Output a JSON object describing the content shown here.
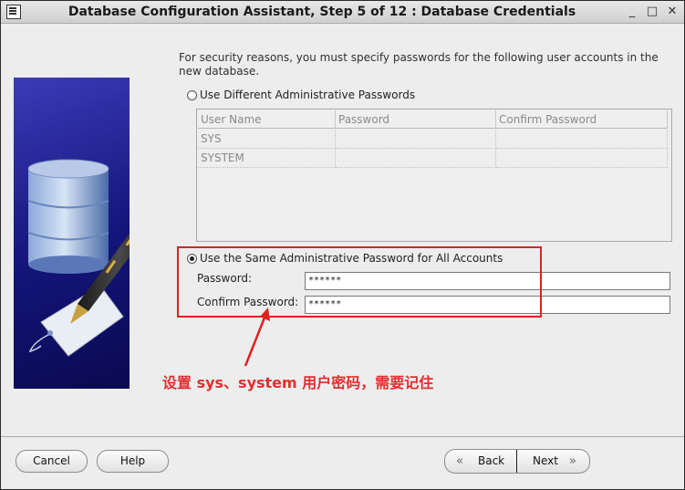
{
  "window": {
    "title": "Database Configuration Assistant, Step 5 of 12 : Database Credentials",
    "buttons": {
      "minimize": "_",
      "maximize": "□",
      "close": "✕"
    }
  },
  "intro": "For security reasons, you must specify passwords for the following user accounts in the new database.",
  "options": {
    "different": {
      "label": "Use Different Administrative Passwords",
      "selected": false
    },
    "same": {
      "label": "Use the Same Administrative Password for All Accounts",
      "selected": true
    }
  },
  "table": {
    "headers": [
      "User Name",
      "Password",
      "Confirm Password"
    ],
    "rows": [
      {
        "user": "SYS",
        "password": "",
        "confirm": ""
      },
      {
        "user": "SYSTEM",
        "password": "",
        "confirm": ""
      }
    ]
  },
  "form": {
    "password_label": "Password:",
    "password_value": "******",
    "confirm_label": "Confirm Password:",
    "confirm_value": "******"
  },
  "annotation": "设置 sys、system 用户密码，需要记住",
  "buttons": {
    "cancel": "Cancel",
    "help": "Help",
    "back": "Back",
    "next": "Next",
    "back_arrow": "«",
    "next_arrow": "»"
  },
  "colors": {
    "annotation": "#e02020",
    "artwork": "#14147a"
  },
  "icons": [
    "window-menu-icon",
    "database-cylinder-icon",
    "fountain-pen-icon",
    "tag-icon",
    "annotation-arrow-icon"
  ]
}
